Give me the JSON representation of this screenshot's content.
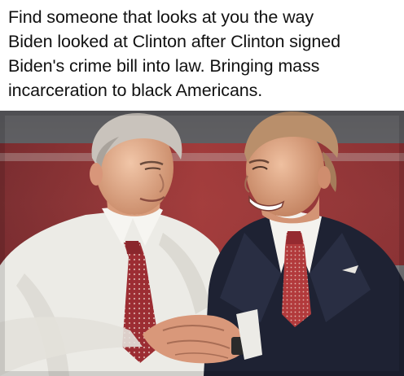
{
  "caption": {
    "lines": [
      "Find someone that looks at you the way",
      "Biden looked at Clinton after Clinton signed",
      "Biden's crime bill into law. Bringing mass",
      "incarceration to black Americans."
    ]
  },
  "photo": {
    "description_icon": "photo-two-men-handshake"
  },
  "colors": {
    "caption_text": "#111111",
    "caption_background": "#ffffff",
    "backdrop_red": "#9e2b2b",
    "backdrop_gray": "#8a8a8a",
    "suit_navy": "#1f2436",
    "shirt_white": "#f2f0ec",
    "tie_red": "#a83236"
  }
}
